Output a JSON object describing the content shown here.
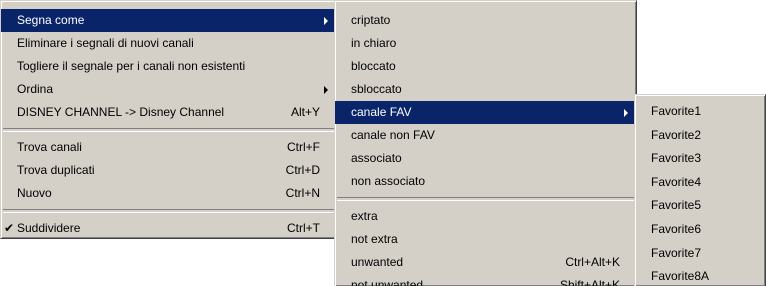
{
  "main_menu": {
    "items": [
      {
        "label": "Segna come",
        "shortcut": "",
        "submenu": true,
        "highlighted": true
      },
      {
        "label": "Eliminare i segnali di nuovi canali",
        "shortcut": ""
      },
      {
        "label": "Togliere il segnale per i canali non esistenti",
        "shortcut": ""
      },
      {
        "label": "Ordina",
        "shortcut": "",
        "submenu": true
      },
      {
        "label": "DISNEY CHANNEL -> Disney Channel",
        "shortcut": "Alt+Y"
      },
      {
        "label": "Trova canali",
        "shortcut": "Ctrl+F"
      },
      {
        "label": "Trova duplicati",
        "shortcut": "Ctrl+D"
      },
      {
        "label": "Nuovo",
        "shortcut": "Ctrl+N"
      },
      {
        "label": "Suddividere",
        "shortcut": "Ctrl+T",
        "checked": true
      }
    ],
    "check_glyph": "✔"
  },
  "segna_submenu": {
    "items": [
      {
        "label": "criptato",
        "shortcut": ""
      },
      {
        "label": "in chiaro",
        "shortcut": ""
      },
      {
        "label": "bloccato",
        "shortcut": ""
      },
      {
        "label": "sbloccato",
        "shortcut": ""
      },
      {
        "label": "canale FAV",
        "shortcut": "",
        "submenu": true,
        "highlighted": true
      },
      {
        "label": "canale non FAV",
        "shortcut": ""
      },
      {
        "label": "associato",
        "shortcut": ""
      },
      {
        "label": "non associato",
        "shortcut": ""
      },
      {
        "label": "extra",
        "shortcut": ""
      },
      {
        "label": "not extra",
        "shortcut": ""
      },
      {
        "label": "unwanted",
        "shortcut": "Ctrl+Alt+K"
      },
      {
        "label": "not unwanted",
        "shortcut": "Shift+Alt+K"
      }
    ]
  },
  "fav_submenu": {
    "items": [
      {
        "label": "Favorite1"
      },
      {
        "label": "Favorite2"
      },
      {
        "label": "Favorite3"
      },
      {
        "label": "Favorite4"
      },
      {
        "label": "Favorite5"
      },
      {
        "label": "Favorite6"
      },
      {
        "label": "Favorite7"
      },
      {
        "label": "Favorite8A"
      }
    ]
  },
  "colors": {
    "menu_bg": "#d4d0c8",
    "highlight_bg": "#0a246a",
    "highlight_text": "#ffffff"
  }
}
